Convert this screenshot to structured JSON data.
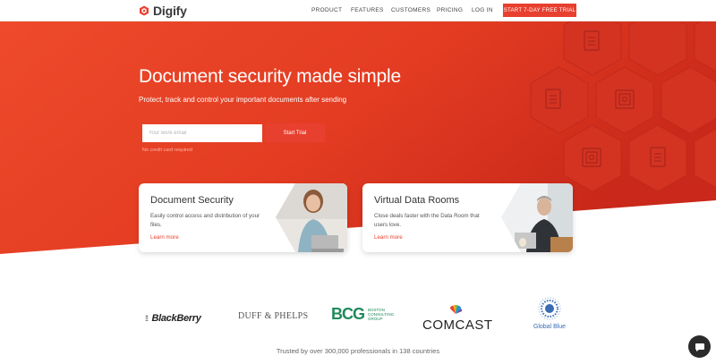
{
  "nav": {
    "brand": "Digify",
    "links": [
      "PRODUCT",
      "FEATURES",
      "CUSTOMERS",
      "PRICING",
      "LOG IN"
    ],
    "cta": "START 7-DAY FREE TRIAL"
  },
  "hero": {
    "title": "Document security made simple",
    "subtitle": "Protect, track and control your important documents after sending",
    "email_placeholder": "Your work email",
    "start_button": "Start Trial",
    "no_card_note": "No credit card required"
  },
  "cards": [
    {
      "title": "Document Security",
      "description": "Easily control access and distribution of your files.",
      "link": "Learn more"
    },
    {
      "title": "Virtual Data Rooms",
      "description": "Close deals faster with the Data Room that users love.",
      "link": "Learn more"
    }
  ],
  "logos": {
    "blackberry": "BlackBerry",
    "duffphelps": "DUFF & PHELPS",
    "bcg_mark": "BCG",
    "bcg_text_1": "BOSTON",
    "bcg_text_2": "CONSULTING",
    "bcg_text_3": "GROUP",
    "comcast": "COMCAST",
    "globalblue": "Global Blue"
  },
  "trusted_text": "Trusted by over 300,000 professionals in 138 countries",
  "colors": {
    "brand_red": "#e8402f",
    "hero_dark": "#c9281a",
    "hero_light": "#ee4a2b"
  }
}
